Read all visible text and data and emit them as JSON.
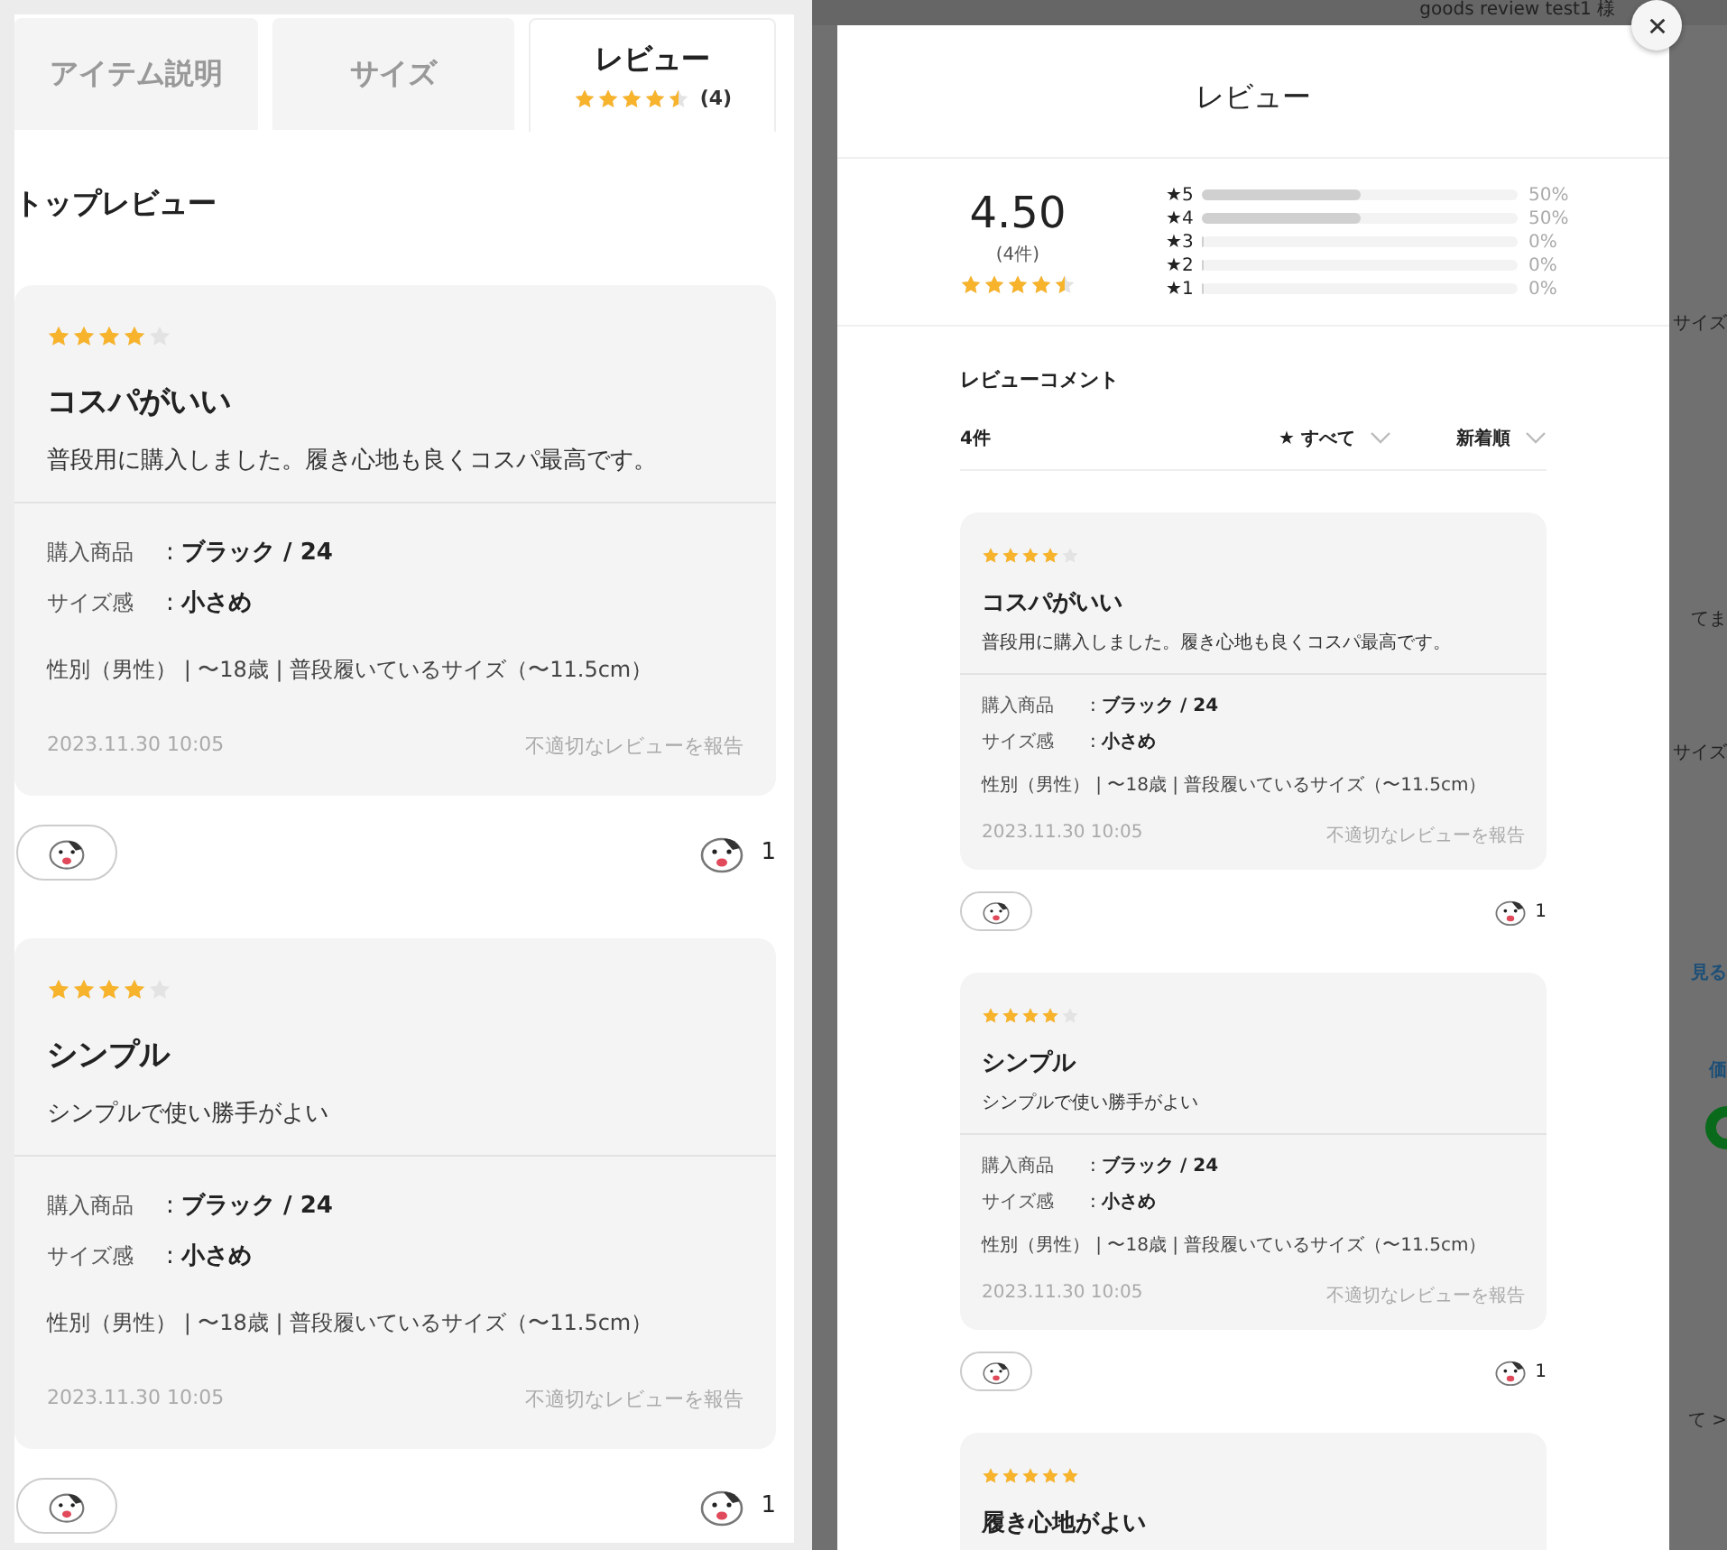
{
  "tabs": [
    {
      "label": "アイテム説明",
      "selected": false
    },
    {
      "label": "サイズ",
      "selected": false
    },
    {
      "label": "レビュー",
      "selected": true,
      "stars": 4.5,
      "count": "(4)"
    }
  ],
  "top_reviews": {
    "heading": "トップレビュー",
    "reviews": [
      {
        "stars": 4,
        "title": "コスパがいい",
        "body": "普段用に購入しました。履き心地も良くコスパ最高です。",
        "details": [
          {
            "label": "購入商品",
            "value": ": **ブラック / 24**"
          },
          {
            "label": "サイズ感",
            "value": ": **小さめ**"
          }
        ],
        "profile": "性別（男性） | 〜18歳 | 普段履いているサイズ（〜11.5cm）",
        "date": "2023.11.30 10:05",
        "report": "不適切なレビューを報告",
        "reactions": "1"
      },
      {
        "stars": 4,
        "title": "シンプル",
        "body": "シンプルで使い勝手がよい",
        "details": [
          {
            "label": "購入商品",
            "value": ": **ブラック / 24**"
          },
          {
            "label": "サイズ感",
            "value": ": **小さめ**"
          }
        ],
        "profile": "性別（男性） | 〜18歳 | 普段履いているサイズ（〜11.5cm）",
        "date": "2023.11.30 10:05",
        "report": "不適切なレビューを報告",
        "reactions": "1"
      }
    ]
  },
  "background": {
    "user": "goods review test1 様",
    "fragments": [
      {
        "kind": "text",
        "text": "サイズ"
      },
      {
        "kind": "text",
        "text": "てま"
      },
      {
        "kind": "text",
        "text": "サイズ"
      },
      {
        "kind": "link",
        "text": "見る"
      },
      {
        "kind": "link",
        "text": "価"
      },
      {
        "kind": "ring"
      },
      {
        "kind": "text",
        "text": "て >"
      }
    ]
  },
  "modal": {
    "title": "レビュー",
    "summary": {
      "score": "4.50",
      "count": "(4件)",
      "stars": 4.5,
      "distribution": [
        {
          "label": "★5",
          "level": 0.5,
          "reading": "50%"
        },
        {
          "label": "★4",
          "level": 0.5,
          "reading": "50%"
        },
        {
          "label": "★3",
          "level": 0,
          "reading": "0%"
        },
        {
          "label": "★2",
          "level": 0,
          "reading": "0%"
        },
        {
          "label": "★1",
          "level": 0,
          "reading": "0%"
        }
      ]
    },
    "comments_title": "レビューコメント",
    "total": "4件",
    "filter": "★ すべて",
    "sort": "新着順",
    "reviews": [
      {
        "stars": 4,
        "title": "コスパがいい",
        "body": "普段用に購入しました。履き心地も良くコスパ最高です。",
        "details": [
          {
            "label": "購入商品",
            "value": ": **ブラック / 24**"
          },
          {
            "label": "サイズ感",
            "value": ": **小さめ**"
          }
        ],
        "profile": "性別（男性） | 〜18歳 | 普段履いているサイズ（〜11.5cm）",
        "date": "2023.11.30 10:05",
        "report": "不適切なレビューを報告",
        "reactions": "1"
      },
      {
        "stars": 4,
        "title": "シンプル",
        "body": "シンプルで使い勝手がよい",
        "details": [
          {
            "label": "購入商品",
            "value": ": **ブラック / 24**"
          },
          {
            "label": "サイズ感",
            "value": ": **小さめ**"
          }
        ],
        "profile": "性別（男性） | 〜18歳 | 普段履いているサイズ（〜11.5cm）",
        "date": "2023.11.30 10:05",
        "report": "不適切なレビューを報告",
        "reactions": "1"
      },
      {
        "stars": 5,
        "title": "履き心地がよい"
      }
    ]
  }
}
